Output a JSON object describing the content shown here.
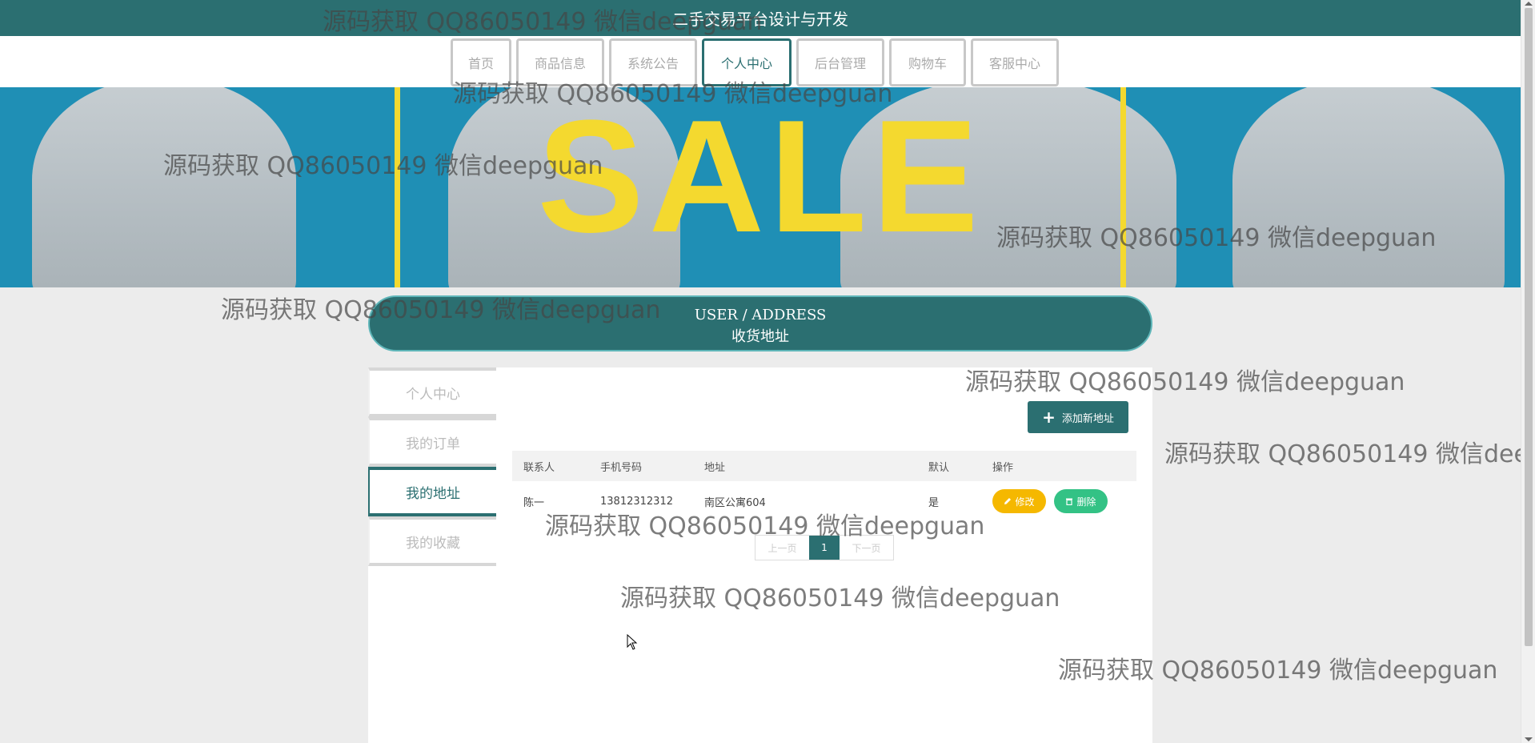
{
  "site_title": "二手交易平台设计与开发",
  "nav": {
    "items": [
      {
        "label": "首页",
        "active": false
      },
      {
        "label": "商品信息",
        "active": false
      },
      {
        "label": "系统公告",
        "active": false
      },
      {
        "label": "个人中心",
        "active": true
      },
      {
        "label": "后台管理",
        "active": false
      },
      {
        "label": "购物车",
        "active": false
      },
      {
        "label": "客服中心",
        "active": false
      }
    ]
  },
  "banner": {
    "text": "SALE",
    "bg_color": "#1f8fb5",
    "text_color": "#f4d92f"
  },
  "section": {
    "title_en": "USER / ADDRESS",
    "title_cn": "收货地址"
  },
  "sidebar": {
    "items": [
      {
        "label": "个人中心",
        "active": false
      },
      {
        "label": "我的订单",
        "active": false
      },
      {
        "label": "我的地址",
        "active": true
      },
      {
        "label": "我的收藏",
        "active": false
      }
    ]
  },
  "toolbar": {
    "add_label": "添加新地址"
  },
  "table": {
    "headers": [
      "联系人",
      "手机号码",
      "地址",
      "默认",
      "操作"
    ],
    "rows": [
      {
        "contact": "陈一",
        "phone": "13812312312",
        "address": "南区公寓604",
        "default": "是",
        "edit_label": "修改",
        "delete_label": "删除"
      }
    ]
  },
  "pager": {
    "prev_label": "上一页",
    "current": "1",
    "next_label": "下一页"
  },
  "watermark": "源码获取 QQ86050149 微信deepguan",
  "colors": {
    "primary": "#2b6f71",
    "edit": "#f5b800",
    "delete": "#33c285",
    "page_bg": "#ececec"
  }
}
